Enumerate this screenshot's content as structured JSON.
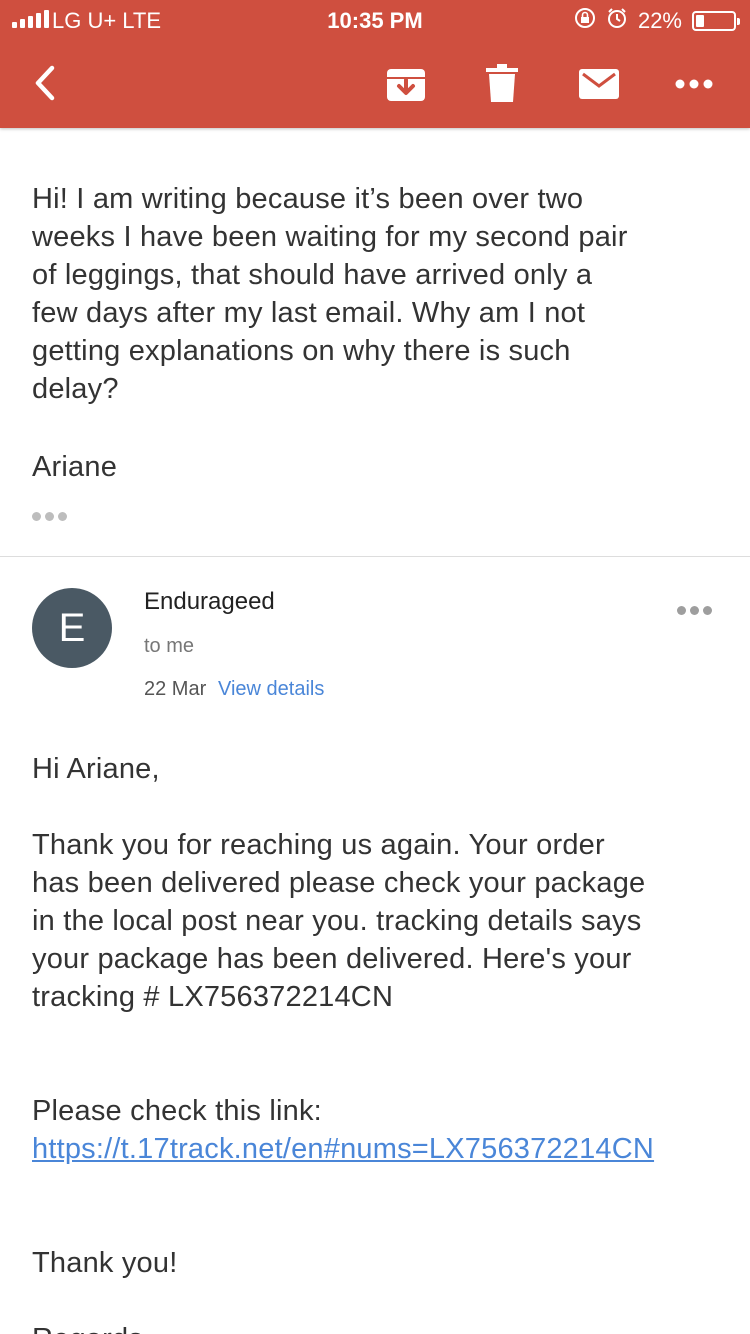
{
  "status_bar": {
    "carrier": "LG U+  LTE",
    "time": "10:35 PM",
    "battery": "22%",
    "battery_level": 0.22
  },
  "toolbar": {
    "back_icon": "chevron-left-icon",
    "archive_icon": "archive-icon",
    "delete_icon": "trash-icon",
    "mark_unread_icon": "envelope-icon",
    "more_icon": "more-horizontal-icon",
    "accent": "#cf4f3f"
  },
  "message1": {
    "body_lines": [
      "Hi! I am writing because it’s been over two",
      "weeks I have been waiting for my second pair",
      "of leggings, that should have arrived only a",
      "few days after my last email. Why am I not",
      "getting explanations on why there is such",
      "delay?"
    ],
    "signature": "Ariane"
  },
  "message2": {
    "avatar_letter": "E",
    "sender": "Endurageed",
    "recipient": "to me",
    "date": "22 Mar",
    "view_details": "View details",
    "greeting": "Hi Ariane,",
    "body_lines": [
      "Thank you for reaching us again. Your order",
      "has been delivered please check your package",
      "in the local post near you. tracking details says",
      "your package has been delivered. Here's your",
      "tracking # LX756372214CN"
    ],
    "link_intro": "Please check this link:",
    "link": "https://t.17track.net/en#nums=LX756372214CN",
    "closing": "Thank you!",
    "regards": "Regards"
  }
}
